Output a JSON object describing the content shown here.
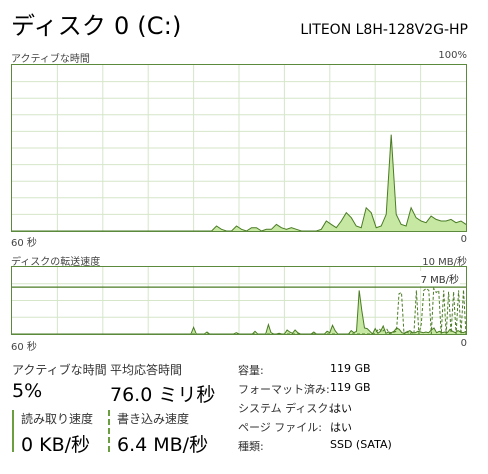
{
  "header": {
    "title": "ディスク 0 (C:)",
    "model": "LITEON L8H-128V2G-HP"
  },
  "active_time_chart": {
    "label": "アクティブな時間",
    "max_label": "100%",
    "time_left": "60 秒",
    "time_right": "0",
    "chart_data": {
      "type": "area",
      "ylim": [
        0,
        100
      ],
      "y": [
        0,
        0,
        0,
        0,
        0,
        0,
        0,
        0,
        0,
        0,
        0,
        0,
        0,
        0,
        0,
        0,
        0,
        0,
        0,
        0,
        0,
        0,
        0,
        0,
        0,
        0,
        0,
        0,
        0,
        0,
        0,
        0,
        0,
        0,
        0,
        0,
        0,
        0,
        0,
        0,
        0,
        3,
        1,
        0,
        0,
        3,
        1,
        0,
        2,
        2,
        0,
        1,
        1,
        4,
        2,
        1,
        2,
        1,
        0,
        0,
        0,
        0,
        1,
        6,
        4,
        2,
        6,
        11,
        8,
        3,
        2,
        14,
        11,
        2,
        3,
        10,
        58,
        10,
        4,
        3,
        14,
        8,
        6,
        5,
        9,
        7,
        6,
        6,
        7,
        5,
        6,
        4
      ]
    }
  },
  "transfer_chart": {
    "label": "ディスクの転送速度",
    "max_label": "10 MB/秒",
    "ref_label": "7 MB/秒",
    "time_left": "60 秒",
    "time_right": "0",
    "chart_data": {
      "type": "line",
      "ylim": [
        0,
        10
      ],
      "reference_line": 7,
      "series": [
        {
          "values": [
            0,
            0,
            0,
            0,
            0,
            0,
            0,
            0,
            0,
            0,
            0,
            0,
            0,
            0,
            0,
            0,
            0,
            0,
            0,
            0,
            0,
            0,
            0,
            0,
            0,
            0,
            0,
            0,
            0,
            0,
            0,
            0,
            0,
            0,
            0,
            0,
            0,
            0,
            0,
            0,
            0,
            0,
            0,
            0,
            0,
            0,
            0,
            0,
            0,
            0,
            0,
            0,
            0,
            0,
            0,
            0,
            0,
            0,
            0,
            0,
            0,
            0,
            0,
            0,
            0,
            0,
            0,
            0,
            1,
            0,
            0,
            0,
            0,
            0.3,
            0,
            0,
            0,
            0,
            0,
            0,
            0,
            0,
            0,
            0,
            0.2,
            0,
            0,
            0,
            0,
            0,
            0,
            0.4,
            0,
            0,
            0,
            0,
            1.4,
            0.2,
            0,
            0,
            0.1,
            0,
            0,
            0.6,
            0.3,
            0.1,
            0.6,
            0.2,
            0,
            0,
            0,
            0,
            0,
            0.3,
            0,
            0,
            0,
            0,
            0.4,
            0.2,
            1.3,
            0.5,
            0,
            0,
            0,
            0,
            0,
            0.5,
            0.2,
            0.4,
            6.5,
            3.5,
            0.9,
            0.8,
            0.4,
            0,
            0.8,
            0.1,
            0.4,
            1.2,
            0.1,
            0.3,
            0.2,
            0.4,
            0.9,
            0.7,
            0.2,
            0.1,
            0.3,
            0.5,
            0.2,
            0.2,
            0.4,
            0.3,
            0.2,
            0.3,
            0.2,
            0.6,
            0.9,
            0.2,
            0.4,
            0.2,
            0.3,
            0.2,
            0.7,
            0.4,
            0.2,
            0.5,
            0.3,
            0.2,
            0.4
          ]
        },
        {
          "values": [
            0,
            0,
            0,
            0,
            0,
            0,
            0,
            0,
            0,
            0,
            0,
            0,
            0,
            0,
            0,
            0,
            0,
            0,
            0,
            0,
            0,
            0,
            0,
            0,
            0,
            0,
            0,
            0,
            0,
            0,
            0,
            0,
            0,
            0,
            0,
            0,
            0,
            0,
            0,
            0,
            0,
            0,
            0,
            0,
            0,
            0,
            0,
            0,
            0,
            0,
            0,
            0,
            0,
            0,
            0,
            0,
            0,
            0,
            0,
            0,
            0,
            0,
            0,
            0,
            0,
            0,
            0,
            0,
            0,
            0,
            0,
            0,
            0,
            0,
            0,
            0,
            0,
            0,
            0,
            0,
            0,
            0,
            0,
            0,
            0,
            0,
            0,
            0,
            0,
            0,
            0,
            0,
            0,
            0,
            0,
            0,
            0,
            0,
            0,
            0,
            0,
            0,
            0,
            0,
            0,
            0,
            0,
            0,
            0,
            0,
            0,
            0,
            0,
            0,
            0,
            0,
            0,
            0,
            0,
            0,
            0,
            0,
            0,
            0,
            0,
            0,
            0,
            0,
            0,
            0,
            0,
            0,
            0,
            0,
            0,
            0,
            0,
            0,
            0,
            0,
            0,
            0,
            0,
            0,
            0,
            0,
            0,
            0.4,
            0.8,
            0.3,
            0.6,
            0.8,
            0.1,
            0,
            0.3,
            0.4,
            6.0,
            6.2,
            0,
            0.5,
            0,
            0.2,
            0,
            6.5,
            0,
            1.5,
            6.5,
            6.8,
            6.5,
            0,
            6.8,
            6.2,
            6.5,
            0,
            6.5,
            0,
            6.3,
            0.2,
            6.3,
            0,
            6.5,
            0,
            6.6,
            0
          ]
        }
      ]
    }
  },
  "stats": {
    "active_time": {
      "label": "アクティブな時間",
      "value": "5%"
    },
    "avg_response": {
      "label": "平均応答時間",
      "value": "76.0 ミリ秒"
    },
    "read_speed": {
      "label": "読み取り速度",
      "value": "0 KB/秒"
    },
    "write_speed": {
      "label": "書き込み速度",
      "value": "6.4 MB/秒"
    }
  },
  "details": [
    {
      "label": "容量:",
      "value": "119 GB"
    },
    {
      "label": "フォーマット済み:",
      "value": "119 GB"
    },
    {
      "label": "システム ディスク:",
      "value": "はい"
    },
    {
      "label": "ページ ファイル:",
      "value": "はい"
    },
    {
      "label": "種類:",
      "value": "SSD (SATA)"
    }
  ],
  "colors": {
    "border": "#5b8a3c",
    "fill": "#c6e8a2",
    "line": "#4a7b24",
    "grid": "#d6e6c9"
  }
}
